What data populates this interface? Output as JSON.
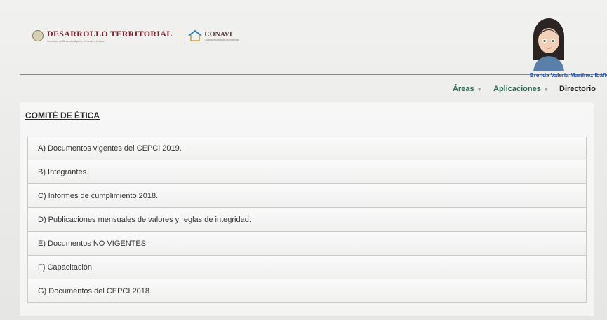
{
  "header": {
    "brand_title": "DESARROLLO TERRITORIAL",
    "brand_subtitle": "Secretaría de Desarrollo Agrario, Territorial y Urbano",
    "conavi_title": "CONAVI",
    "conavi_subtitle": "Comisión Nacional de Vivienda",
    "user_name": "Brenda Valeria Martínez Ibáñez"
  },
  "nav": {
    "areas": "Áreas",
    "applications": "Aplicaciones",
    "directory": "Directorio",
    "caret": "▾"
  },
  "panel": {
    "title": "COMITÉ DE ÉTICA",
    "items": [
      "A) Documentos vigentes del CEPCI 2019.",
      "B) Integrantes.",
      "C) Informes de cumplimiento 2018.",
      "D) Publicaciones mensuales de valores y reglas de integridad.",
      "E) Documentos NO VIGENTES.",
      "F) Capacitación.",
      "G) Documentos del CEPCI 2018."
    ]
  },
  "colors": {
    "brand": "#7a1f2b",
    "nav_link": "#2b6a57",
    "user_link": "#1e4fa8"
  },
  "icons": {
    "seal": "government-seal-icon",
    "house": "house-icon",
    "avatar": "user-avatar"
  }
}
